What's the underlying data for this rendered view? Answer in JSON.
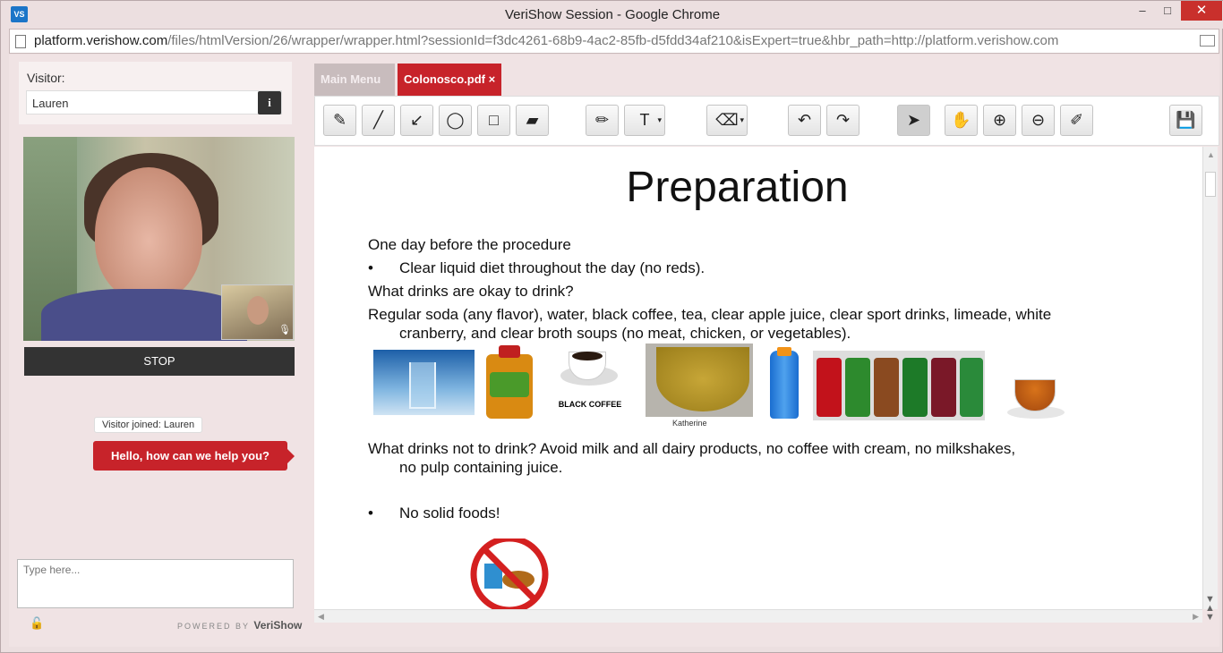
{
  "window": {
    "app_icon": "VS",
    "title": "VeriShow Session - Google Chrome",
    "min_glyph": "–",
    "max_glyph": "□",
    "close_glyph": "✕"
  },
  "address_bar": {
    "host": "platform.verishow.com",
    "path": "/files/htmlVersion/26/wrapper/wrapper.html?sessionId=f3dc4261-68b9-4ac2-85fb-d5fdd34af210&isExpert=true&hbr_path=http://platform.verishow.com"
  },
  "visitor": {
    "label": "Visitor:",
    "name": "Lauren",
    "info_glyph": "i"
  },
  "video": {
    "stop_label": "STOP",
    "mic_glyph": "🎙"
  },
  "chat": {
    "system_message": "Visitor joined: Lauren",
    "agent_message": "Hello, how can we help you?",
    "input_placeholder": "Type here..."
  },
  "footer": {
    "powered_by": "POWERED BY",
    "brand": "VeriShow",
    "lock_glyph": "🔓"
  },
  "tabs": [
    {
      "label": "Main Menu"
    },
    {
      "label": "Colonosco.pdf",
      "close_glyph": "×"
    }
  ],
  "toolbar": {
    "pen_glyph": "✎",
    "line_glyph": "╱",
    "arrow_glyph": "↙",
    "circle_glyph": "◯",
    "rect_glyph": "□",
    "marker_glyph": "▰",
    "highlighter_glyph": "✏",
    "text_glyph": "T",
    "eraser_glyph": "⌫",
    "undo_glyph": "↶",
    "redo_glyph": "↷",
    "select_glyph": "➤",
    "hand_glyph": "✋",
    "zoom_in_glyph": "⊕",
    "zoom_out_glyph": "⊖",
    "clear_glyph": "✐",
    "save_glyph": "💾",
    "dropdown_glyph": "▾"
  },
  "document": {
    "title": "Preparation",
    "line1": "One day before the procedure",
    "bullet": "•",
    "line2": "Clear liquid diet throughout the day (no reds).",
    "line3": "What drinks are okay to drink?",
    "line4a": "Regular soda (any flavor), water, black coffee, tea, clear apple juice, clear sport drinks, limeade, white",
    "line4b": "cranberry, and clear broth soups (no meat, chicken, or vegetables).",
    "coffee_caption": "BLACK COFFEE",
    "broth_caption": "Katherine",
    "line5a": "What drinks not to drink? Avoid milk and all dairy products, no coffee with cream, no milkshakes,",
    "line5b": "no pulp containing juice.",
    "line6": "No solid foods!"
  },
  "colors": {
    "brand_red": "#c7232a",
    "dark": "#333333"
  }
}
